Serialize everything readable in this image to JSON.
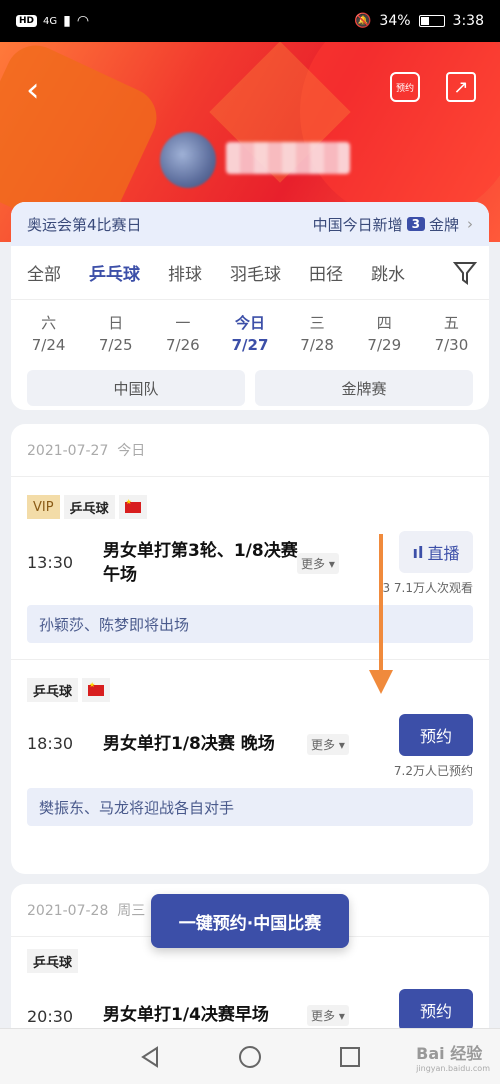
{
  "status_bar": {
    "left": "HD",
    "network": "4G",
    "battery": "34%",
    "time": "3:38"
  },
  "header": {
    "calendar_label": "预约"
  },
  "olympic_bar": {
    "day_text": "奥运会第4比赛日",
    "china_new_text": "中国今日新增",
    "gold_count": "3",
    "gold_text": "金牌"
  },
  "sport_tabs": [
    "全部",
    "乒乓球",
    "排球",
    "羽毛球",
    "田径",
    "跳水"
  ],
  "days": [
    {
      "weekday": "六",
      "date": "7/24"
    },
    {
      "weekday": "日",
      "date": "7/25"
    },
    {
      "weekday": "一",
      "date": "7/26"
    },
    {
      "weekday": "今日",
      "date": "7/27"
    },
    {
      "weekday": "三",
      "date": "7/28"
    },
    {
      "weekday": "四",
      "date": "7/29"
    },
    {
      "weekday": "五",
      "date": "7/30"
    }
  ],
  "filters": {
    "team": "中国队",
    "gold": "金牌赛"
  },
  "section1": {
    "date": "2021-07-27",
    "label": "今日"
  },
  "match1": {
    "vip": "VIP",
    "sport": "乒乓球",
    "time": "13:30",
    "title": "男女单打第3轮、1/8决赛午场",
    "more": "更多",
    "button": "直播",
    "stat": "3 7.1万人次观看",
    "note": "孙颖莎、陈梦即将出场"
  },
  "match2": {
    "sport": "乒乓球",
    "time": "18:30",
    "title": "男女单打1/8决赛 晚场",
    "more": "更多",
    "button": "预约",
    "stat": "7.2万人已预约",
    "note": "樊振东、马龙将迎战各自对手"
  },
  "section2": {
    "date": "2021-07-28",
    "label": "周三"
  },
  "match3": {
    "sport": "乒乓球",
    "time": "20:30",
    "title": "男女单打1/4决赛早场",
    "more": "更多",
    "button": "预约"
  },
  "float_button": "一键预约·中国比赛",
  "watermark": {
    "main": "Bai 经验",
    "sub": "jingyan.baidu.com"
  },
  "colors": {
    "accent": "#3c4fa8",
    "arrow": "#f08a3c"
  }
}
